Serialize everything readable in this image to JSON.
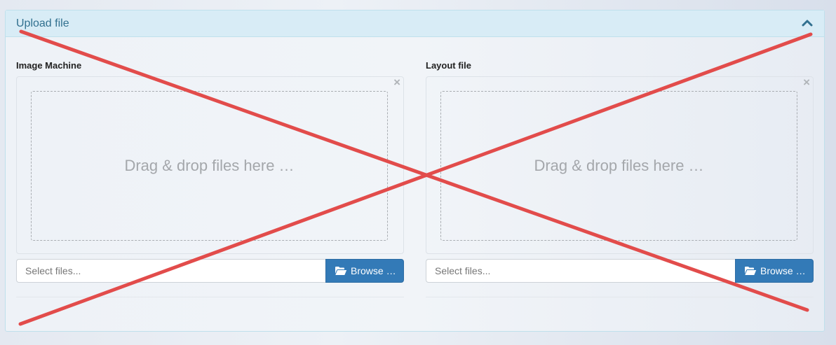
{
  "panel": {
    "title": "Upload file",
    "collapse_icon": "chevron-up-icon"
  },
  "uploaders": [
    {
      "label": "Image Machine",
      "drop_text": "Drag & drop files here …",
      "close_symbol": "×",
      "input_placeholder": "Select files...",
      "browse_label": "Browse …",
      "browse_icon": "folder-open-icon"
    },
    {
      "label": "Layout file",
      "drop_text": "Drag & drop files here …",
      "close_symbol": "×",
      "input_placeholder": "Select files...",
      "browse_label": "Browse …",
      "browse_icon": "folder-open-icon"
    }
  ],
  "colors": {
    "header_bg": "#d8ecf6",
    "title_text": "#31708f",
    "browse_button": "#337ab7",
    "cross_overlay": "#e24c4b"
  }
}
